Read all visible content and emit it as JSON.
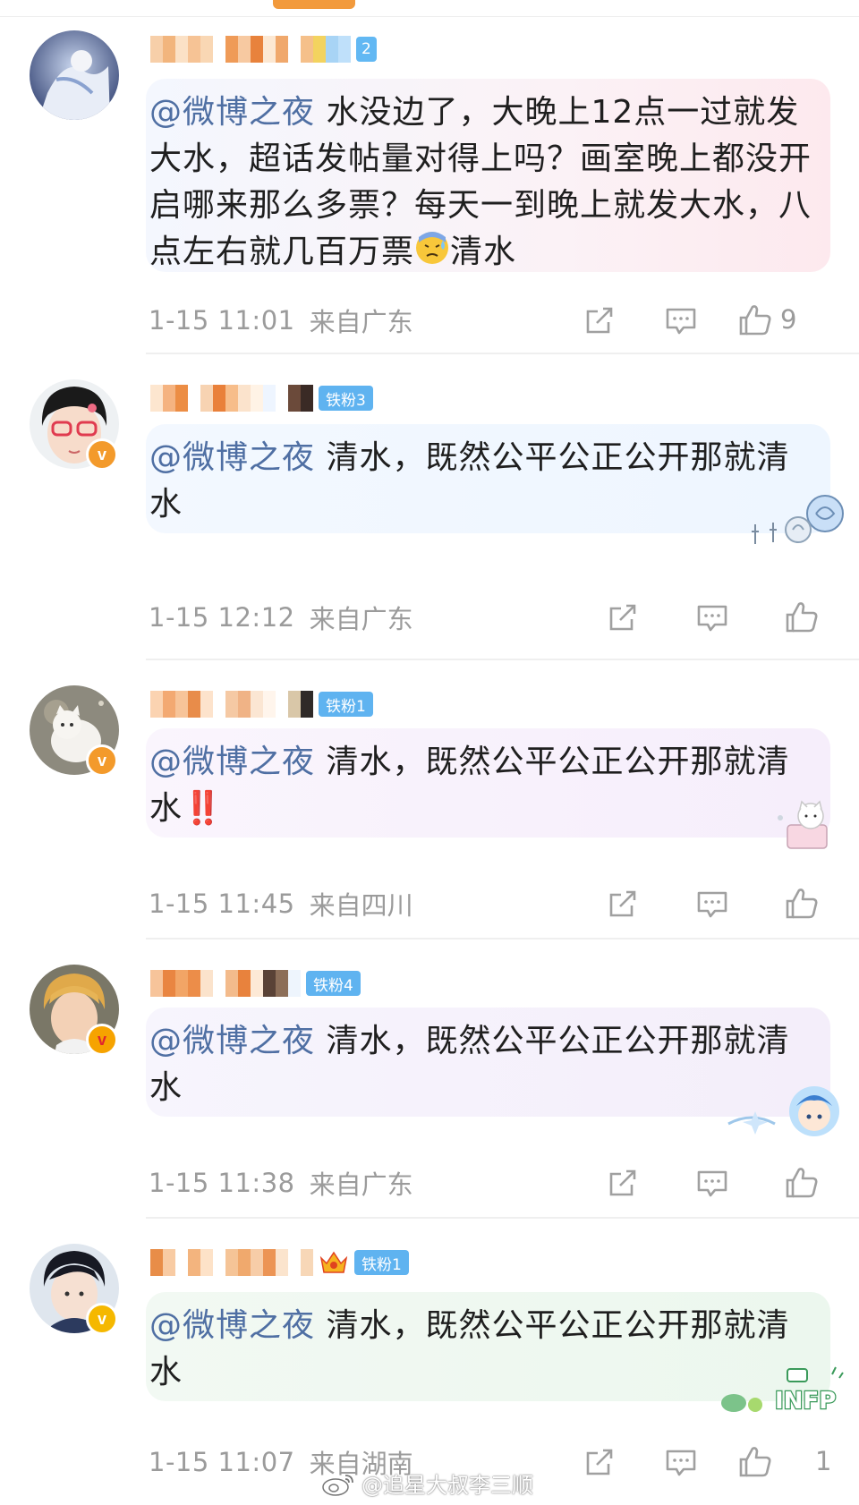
{
  "colors": {
    "mention": "#4f6fa3",
    "meta": "#9b9b9b",
    "fan_badge": "#5eb6f2",
    "verified_orange": "#f39a2b",
    "verified_gold": "#f5b800",
    "top_indicator": "#f29a3c"
  },
  "comments": [
    {
      "fan_badge": "2",
      "verified": false,
      "mention": "@微博之夜",
      "text": " 水没边了，大晚上12点一过就发大水，超话发帖量对得上吗？画室晚上都没开启哪来那么多票？每天一到晚上就发大水，八点左右就几百万票",
      "text_tail": "清水",
      "time": "1-15 11:01",
      "location": "来自广东",
      "likes": "9"
    },
    {
      "fan_badge": "铁粉3",
      "verified": true,
      "mention": "@微博之夜",
      "text": " 清水，既然公平公正公开那就清水",
      "text_tail": "",
      "time": "1-15 12:12",
      "location": "来自广东",
      "likes": ""
    },
    {
      "fan_badge": "铁粉1",
      "verified": true,
      "mention": "@微博之夜",
      "text": " 清水，既然公平公正公开那就清水",
      "text_tail": "‼️",
      "time": "1-15 11:45",
      "location": "来自四川",
      "likes": ""
    },
    {
      "fan_badge": "铁粉4",
      "verified": true,
      "mention": "@微博之夜",
      "text": " 清水，既然公平公正公开那就清水",
      "text_tail": "",
      "time": "1-15 11:38",
      "location": "来自广东",
      "likes": ""
    },
    {
      "fan_badge": "铁粉1",
      "verified": true,
      "mention": "@微博之夜",
      "text": " 清水，既然公平公正公开那就清水",
      "text_tail": "",
      "time": "1-15 11:07",
      "location": "来自湖南",
      "likes": "1"
    }
  ],
  "icons": {
    "share": "share-icon",
    "comment": "comment-icon",
    "like": "thumbs-up-icon",
    "emoji_sweat": "sweat-face-emoji",
    "weibo_logo": "weibo-logo-icon"
  },
  "watermark": "@追星大叔李三顺"
}
